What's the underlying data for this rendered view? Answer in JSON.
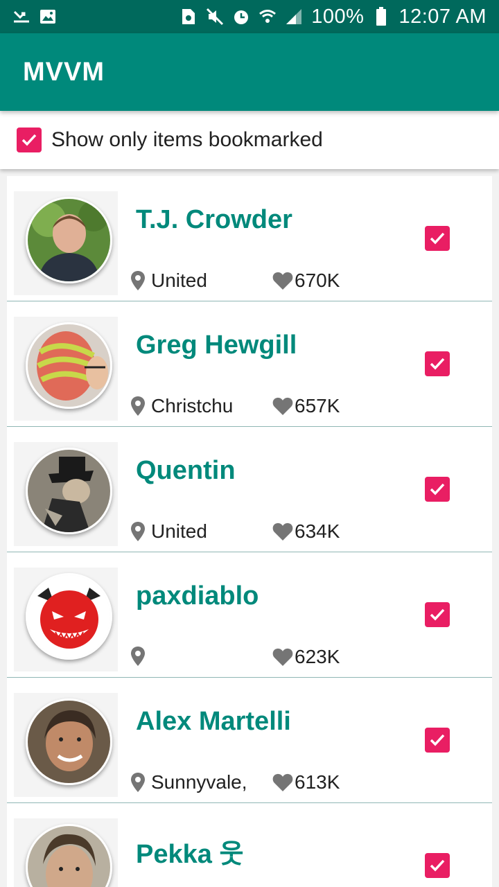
{
  "status_bar": {
    "battery": "100%",
    "time": "12:07 AM",
    "icons": [
      "missed-call-icon",
      "image-icon",
      "sim-icon",
      "mute-icon",
      "alarm-icon",
      "wifi-icon",
      "signal-icon",
      "battery-icon"
    ]
  },
  "app_bar": {
    "title": "MVVM"
  },
  "filter": {
    "label": "Show only items bookmarked",
    "checked": true
  },
  "colors": {
    "primary": "#00897b",
    "primary_dark": "#00695c",
    "accent": "#e91e63"
  },
  "users": [
    {
      "name": "T.J. Crowder",
      "location": "United",
      "reputation": "670K",
      "bookmarked": true,
      "avatar": "photo"
    },
    {
      "name": "Greg Hewgill",
      "location": "Christchu",
      "reputation": "657K",
      "bookmarked": true,
      "avatar": "photo"
    },
    {
      "name": "Quentin",
      "location": "United",
      "reputation": "634K",
      "bookmarked": true,
      "avatar": "photo"
    },
    {
      "name": "paxdiablo",
      "location": "",
      "reputation": "623K",
      "bookmarked": true,
      "avatar": "devil-icon"
    },
    {
      "name": "Alex Martelli",
      "location": "Sunnyvale,",
      "reputation": "613K",
      "bookmarked": true,
      "avatar": "photo"
    },
    {
      "name": "Pekka 웃",
      "location": "",
      "reputation": "",
      "bookmarked": true,
      "avatar": "photo"
    }
  ]
}
